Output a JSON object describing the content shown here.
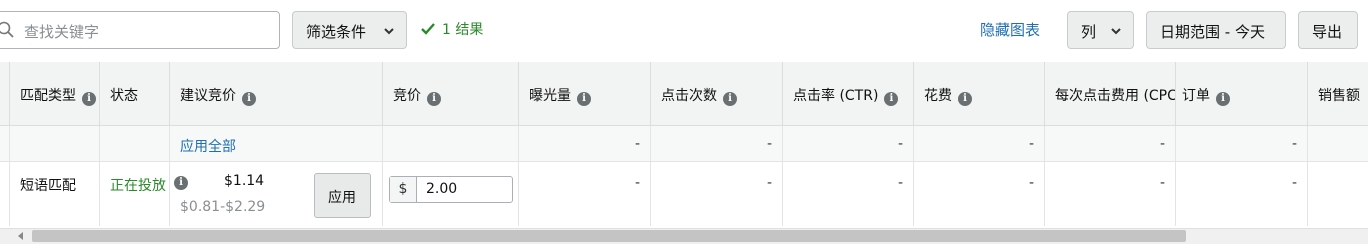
{
  "toolbar": {
    "search_placeholder": "查找关键字",
    "filter_label": "筛选条件",
    "result_count": "1 结果",
    "hide_chart": "隐藏图表",
    "columns_label": "列",
    "date_range": "日期范围 - 今天",
    "export_label": "导出"
  },
  "table": {
    "headers": {
      "match_type": "匹配类型",
      "status": "状态",
      "suggested_bid": "建议竞价",
      "bid": "竞价",
      "impressions": "曝光量",
      "clicks": "点击次数",
      "ctr": "点击率 (CTR)",
      "spend": "花费",
      "cpc": "每次点击费用 (CPC)",
      "orders": "订单",
      "sales": "销售额"
    },
    "summary_row": {
      "apply_all": "应用全部",
      "impressions": "-",
      "clicks": "-",
      "ctr": "-",
      "spend": "-",
      "cpc": "-",
      "orders": "-"
    },
    "row": {
      "match_type": "短语匹配",
      "status": "正在投放",
      "suggested_bid": "$1.14",
      "suggested_range": "$0.81-$2.29",
      "apply_label": "应用",
      "currency": "$",
      "bid_value": "2.00",
      "impressions": "-",
      "clicks": "-",
      "ctr": "-",
      "spend": "-",
      "cpc": "-",
      "orders": "-"
    }
  },
  "colors": {
    "link": "#1f6fb2",
    "status_active": "#2a8a2a",
    "header_bg": "#f2f3f3",
    "info_icon": "#6a7072"
  }
}
